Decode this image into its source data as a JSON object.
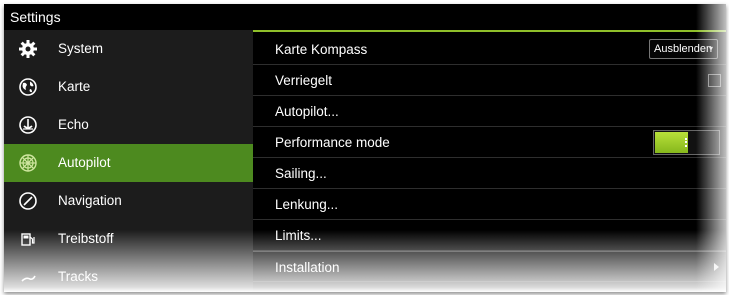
{
  "window": {
    "title": "Settings"
  },
  "sidebar": {
    "items": [
      {
        "label": "System",
        "icon": "gear-icon"
      },
      {
        "label": "Karte",
        "icon": "globe-icon"
      },
      {
        "label": "Echo",
        "icon": "echo-icon"
      },
      {
        "label": "Autopilot",
        "icon": "helm-icon",
        "selected": true
      },
      {
        "label": "Navigation",
        "icon": "compass-icon"
      },
      {
        "label": "Treibstoff",
        "icon": "fuel-pump-icon"
      },
      {
        "label": "Tracks",
        "icon": "tracks-icon"
      }
    ]
  },
  "content": {
    "rows": [
      {
        "label": "Karte Kompass",
        "control": "dropdown",
        "value": "Ausblenden"
      },
      {
        "label": "Verriegelt",
        "control": "checkbox",
        "checked": false
      },
      {
        "label": "Autopilot...",
        "control": "none"
      },
      {
        "label": "Performance mode",
        "control": "toggle",
        "on": true
      },
      {
        "label": "Sailing...",
        "control": "none"
      },
      {
        "label": "Lenkung...",
        "control": "none"
      },
      {
        "label": "Limits...",
        "control": "none"
      },
      {
        "label": "Installation",
        "control": "submenu"
      }
    ]
  },
  "colors": {
    "selection_green": "#4d8a1f",
    "accent_line": "#8fbf2a",
    "toggle_on": "#a6d12e",
    "sidebar_bg": "#1c1c1c",
    "content_bg": "#000000"
  }
}
